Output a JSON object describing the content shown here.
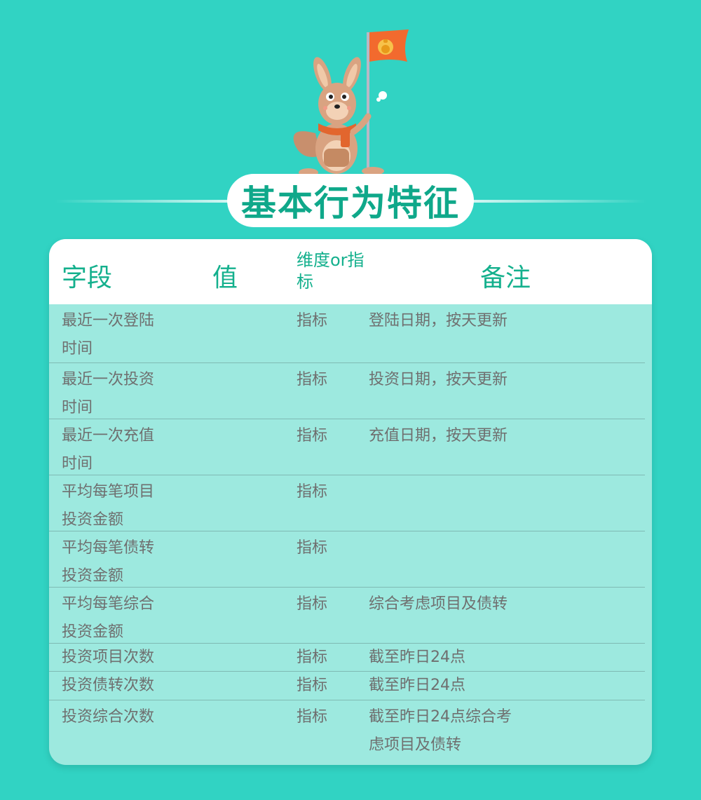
{
  "title": "基本行为特征",
  "table": {
    "headers": {
      "field": "字段",
      "value": "值",
      "dimension": "维度or指标",
      "note": "备注"
    },
    "rows": [
      {
        "field": "最近一次登陆时间",
        "value": "",
        "dimension": "指标",
        "note": "登陆日期，按天更新"
      },
      {
        "field": "最近一次投资时间",
        "value": "",
        "dimension": "指标",
        "note": "投资日期，按天更新"
      },
      {
        "field": "最近一次充值时间",
        "value": "",
        "dimension": "指标",
        "note": "充值日期，按天更新"
      },
      {
        "field": "平均每笔项目投资金额",
        "value": "",
        "dimension": "指标",
        "note": ""
      },
      {
        "field": "平均每笔债转投资金额",
        "value": "",
        "dimension": "指标",
        "note": ""
      },
      {
        "field": "平均每笔综合投资金额",
        "value": "",
        "dimension": "指标",
        "note": "综合考虑项目及债转"
      },
      {
        "field": "投资项目次数",
        "value": "",
        "dimension": "指标",
        "note": "截至昨日24点"
      },
      {
        "field": "投资债转次数",
        "value": "",
        "dimension": "指标",
        "note": "截至昨日24点"
      },
      {
        "field": "投资综合次数",
        "value": "",
        "dimension": "指标",
        "note": "截至昨日24点综合考虑项目及债转"
      }
    ]
  },
  "colors": {
    "background": "#31d3c3",
    "card": "#9de9df",
    "accent": "#14b08d",
    "text": "#6f6f6f",
    "flag": "#f26a2e"
  },
  "icons": {
    "mascot": "kangaroo-with-flag-icon",
    "flag_emblem": "money-bag-icon"
  }
}
